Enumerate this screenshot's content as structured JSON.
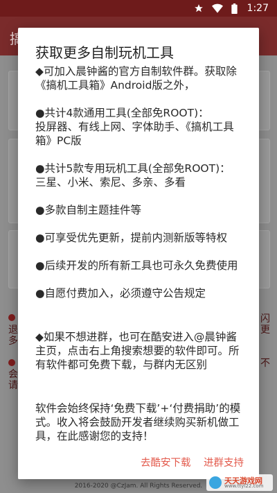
{
  "status_bar": {
    "time": "1:27",
    "icons": [
      "star-icon",
      "wifi-icon",
      "battery-icon"
    ]
  },
  "background_app": {
    "title_char": "搞",
    "side_text_left": [
      "退",
      "多"
    ],
    "side_text_left_2": [
      "会",
      "请"
    ],
    "side_text_right": [
      "闪",
      "更"
    ],
    "side_text_right_2": [
      "不"
    ],
    "footer": "2016-2020 @CzJam. All Rights Reserved."
  },
  "dialog": {
    "title": "获取更多自制玩机工具",
    "paragraphs": [
      "◆可加入晨钟酱的官方自制软件群。获取除《搞机工具箱》Android版之外，",
      "●共计4款通用工具(全部免ROOT)：\n投屏器、有线上网、字体助手、《搞机工具箱》PC版",
      "●共计5款专用玩机工具(全部免ROOT)：\n三星、小米、索尼、多亲、多看",
      "●多款自制主题挂件等",
      "●可享受优先更新，提前内测新版等特权",
      "●后续开发的所有新工具也可永久免费使用",
      "●自愿付费加入，必须遵守公告规定",
      "◆如果不想进群，也可在酷安进入@晨钟酱 主页，点击右上角搜索想要的软件即可。所有软件都可免费下载，与群内无区别",
      "软件会始终保持‘免费下载’+‘付费捐助’的模式。收入将会鼓励开发者继续购买新机做工具，在此感谢您的支持！"
    ],
    "buttons": {
      "coolapk": "去酷安下载",
      "join_group": "进群支持"
    }
  },
  "watermark": {
    "text": "天天游戏网",
    "url": "www.ttyl22.com"
  },
  "colors": {
    "accent": "#e35b4d",
    "status_bar": "#6e1b1b",
    "app_bar": "#7a2b2b",
    "scrim_background": "#8f8f8f"
  }
}
